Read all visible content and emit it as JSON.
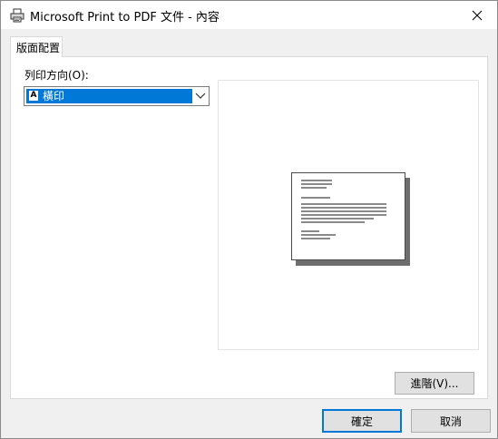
{
  "window": {
    "title": "Microsoft Print to PDF 文件 - 內容"
  },
  "tabs": [
    {
      "label": "版面配置",
      "active": true
    }
  ],
  "layout": {
    "orientation_label": "列印方向(O):",
    "orientation_value": "橫印",
    "orientation_icon_glyph": "A"
  },
  "buttons": {
    "advanced": "進階(V)...",
    "ok": "確定",
    "cancel": "取消"
  },
  "icons": {
    "title": "printer-icon",
    "close": "close-icon",
    "dropdown": "chevron-down-icon",
    "orientation": "landscape-orientation-icon"
  },
  "colors": {
    "accent": "#0078d7",
    "panel_bg": "#ffffff",
    "window_bg": "#f0f0f0"
  }
}
